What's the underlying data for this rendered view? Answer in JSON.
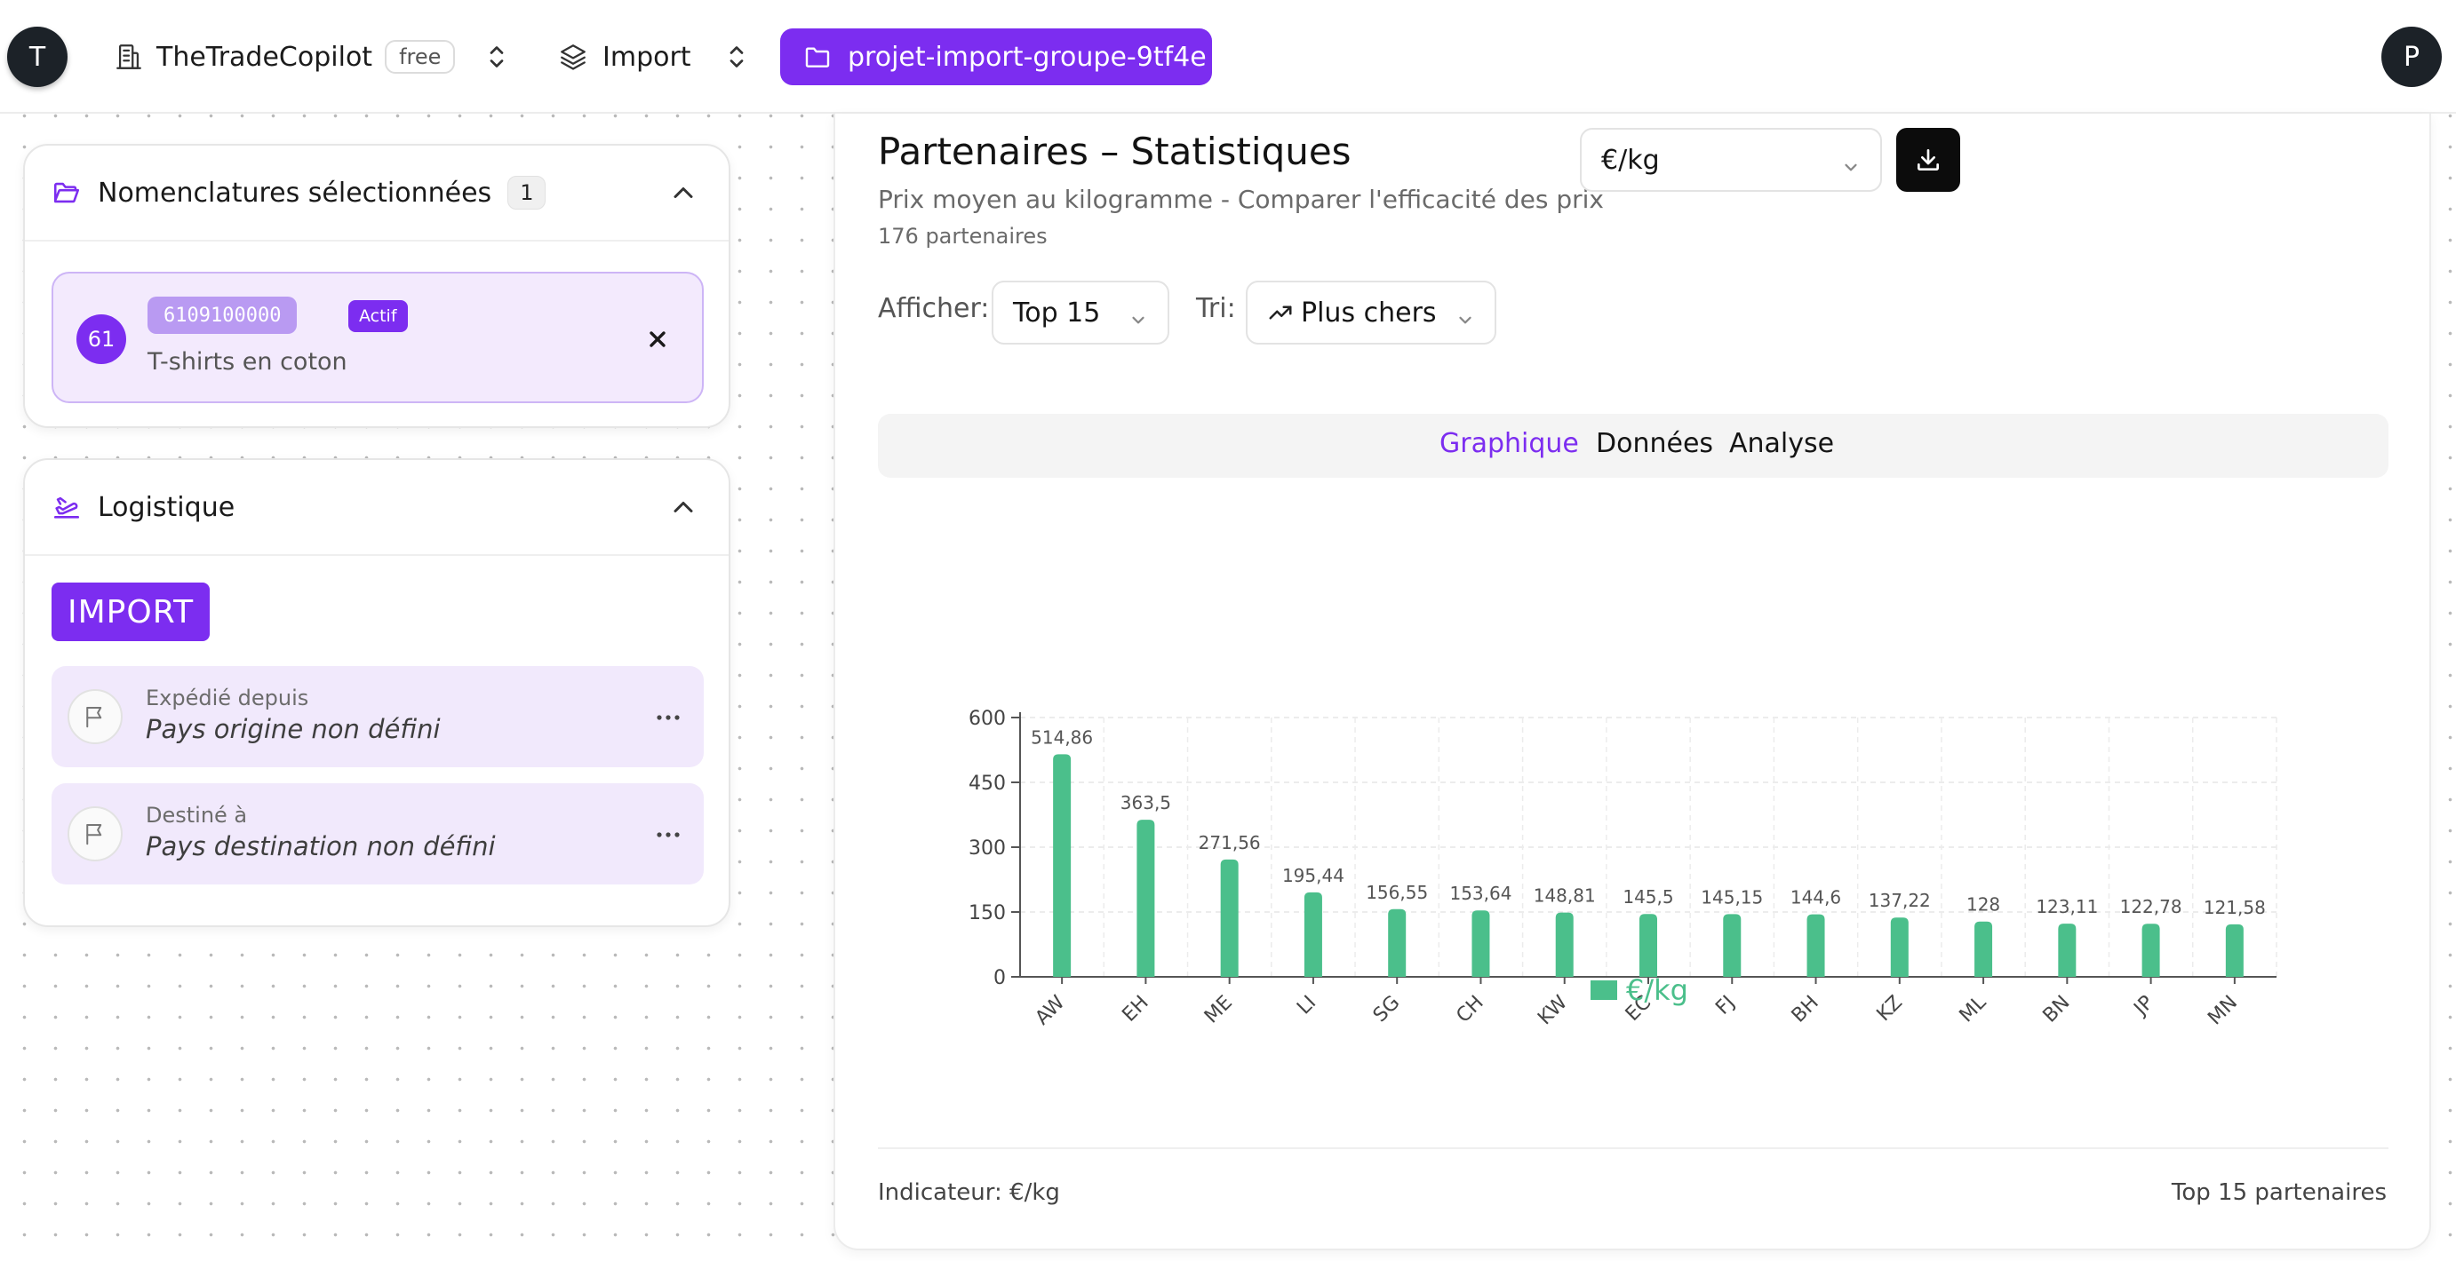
{
  "header": {
    "user_left_initial": "T",
    "org_name": "TheTradeCopilot",
    "plan_badge": "free",
    "mode_label": "Import",
    "project_name": "projet-import-groupe-9tf4e",
    "user_right_initial": "P",
    "accent_color": "#7c2df0"
  },
  "nomenclatures": {
    "title": "Nomenclatures sélectionnées",
    "count": "1",
    "items": [
      {
        "chapter": "61",
        "code": "6109100000",
        "status": "Actif",
        "description": "T-shirts en coton"
      }
    ]
  },
  "logistics": {
    "title": "Logistique",
    "flow_badge": "IMPORT",
    "origin_label": "Expédié depuis",
    "origin_value": "Pays origine non défini",
    "destination_label": "Destiné à",
    "destination_value": "Pays destination non défini"
  },
  "stats": {
    "title": "Partenaires – Statistiques",
    "subtitle": "Prix moyen au kilogramme - Comparer l'efficacité des prix",
    "partner_count": "176 partenaires",
    "indicator_select": "€/kg",
    "display_label": "Afficher:",
    "display_value": "Top 15",
    "sort_label": "Tri:",
    "sort_value": "Plus chers",
    "tabs": [
      "Graphique",
      "Données",
      "Analyse"
    ],
    "active_tab": "Graphique",
    "footer_indicator": "Indicateur: €/kg",
    "footer_scope": "Top 15 partenaires"
  },
  "chart_data": {
    "type": "bar",
    "categories": [
      "AW",
      "EH",
      "ME",
      "LI",
      "SG",
      "CH",
      "KW",
      "EC",
      "FJ",
      "BH",
      "KZ",
      "ML",
      "BN",
      "JP",
      "MN"
    ],
    "series": [
      {
        "name": "€/kg",
        "values": [
          514.86,
          363.5,
          271.56,
          195.44,
          156.55,
          153.64,
          148.81,
          145.5,
          145.15,
          144.6,
          137.22,
          128,
          123.11,
          122.78,
          121.58
        ]
      }
    ],
    "value_labels": [
      "514,86",
      "363,5",
      "271,56",
      "195,44",
      "156,55",
      "153,64",
      "148,81",
      "145,5",
      "145,15",
      "144,6",
      "137,22",
      "128",
      "123,11",
      "122,78",
      "121,58"
    ],
    "yticks": [
      0,
      150,
      300,
      450,
      600
    ],
    "ylim": [
      0,
      600
    ],
    "grid": true,
    "legend": "bottom-center",
    "bar_color": "#4bbf8b"
  }
}
